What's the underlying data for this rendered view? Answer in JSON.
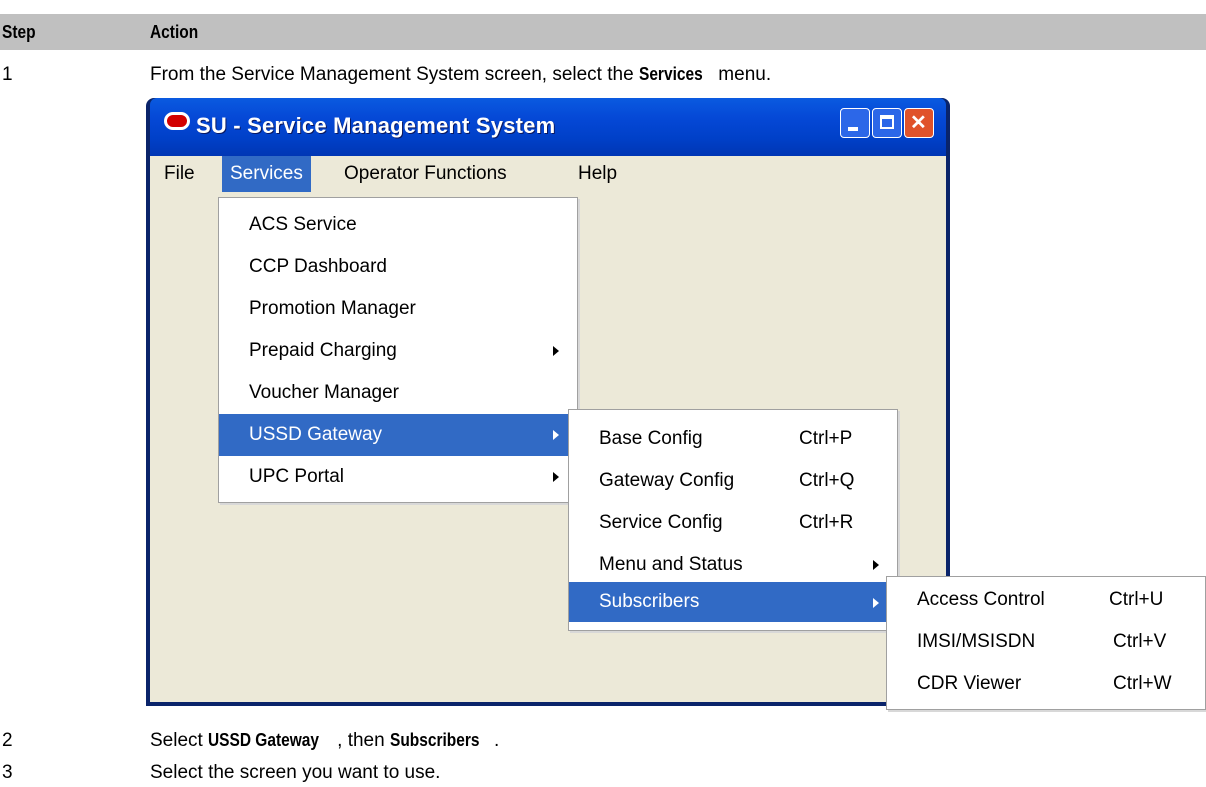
{
  "table": {
    "col_step": "Step",
    "col_action": "Action",
    "rows": [
      {
        "num": "1",
        "prefix": "From the Service Management System screen, select the ",
        "bold": "Services",
        "suffix": " menu."
      },
      {
        "num": "2",
        "prefix": "Select ",
        "bold": "USSD Gateway",
        "mid": ", then ",
        "bold2": "Subscribers",
        "suffix": "."
      },
      {
        "num": "3",
        "text": "Select the screen you want to use."
      }
    ]
  },
  "window": {
    "title": "SU - Service Management System",
    "menubar": [
      "File",
      "Services",
      "Operator Functions",
      "Help"
    ],
    "services_menu": [
      {
        "label": "ACS Service"
      },
      {
        "label": "CCP Dashboard"
      },
      {
        "label": "Promotion Manager"
      },
      {
        "label": "Prepaid Charging",
        "submenu": true
      },
      {
        "label": "Voucher Manager"
      },
      {
        "label": "USSD Gateway",
        "submenu": true,
        "highlighted": true
      },
      {
        "label": "UPC Portal",
        "submenu": true
      }
    ],
    "ussd_menu": [
      {
        "label": "Base Config",
        "shortcut": "Ctrl+P"
      },
      {
        "label": "Gateway Config",
        "shortcut": "Ctrl+Q"
      },
      {
        "label": "Service Config",
        "shortcut": "Ctrl+R"
      },
      {
        "label": "Menu and Status",
        "submenu": true
      },
      {
        "label": "Subscribers",
        "submenu": true,
        "highlighted": true
      }
    ],
    "subscribers_menu": [
      {
        "label": "Access Control",
        "shortcut": "Ctrl+U"
      },
      {
        "label": "IMSI/MSISDN",
        "shortcut": "Ctrl+V"
      },
      {
        "label": "CDR Viewer",
        "shortcut": "Ctrl+W"
      }
    ]
  },
  "colors": {
    "highlight": "#316ac5",
    "titlebar": "#0548d6",
    "client_bg": "#ece9d8",
    "header_bg": "#c0c0c0"
  }
}
